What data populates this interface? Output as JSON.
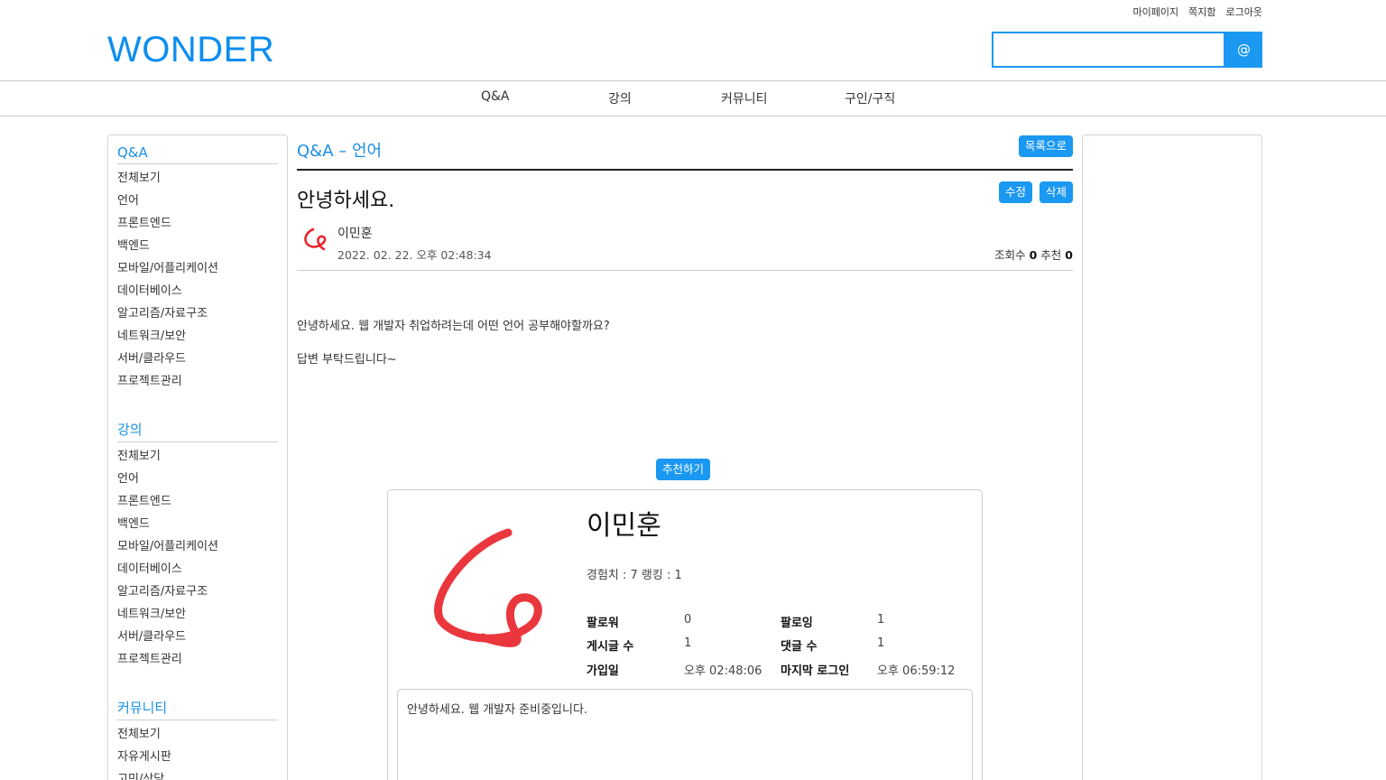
{
  "header": {
    "top_links": [
      "마이페이지",
      "쪽지함",
      "로그아웃"
    ],
    "logo": "WONDER",
    "search": {
      "value": "",
      "button": "@"
    }
  },
  "nav": [
    "Q&A",
    "강의",
    "커뮤니티",
    "구인/구직"
  ],
  "sidebar": [
    {
      "title": "Q&A",
      "items": [
        "전체보기",
        "언어",
        "프론트엔드",
        "백엔드",
        "모바일/어플리케이션",
        "데이터베이스",
        "알고리즘/자료구조",
        "네트워크/보안",
        "서버/클라우드",
        "프로젝트관리"
      ]
    },
    {
      "title": "강의",
      "items": [
        "전체보기",
        "언어",
        "프론트엔드",
        "백엔드",
        "모바일/어플리케이션",
        "데이터베이스",
        "알고리즘/자료구조",
        "네트워크/보안",
        "서버/클라우드",
        "프로젝트관리"
      ]
    },
    {
      "title": "커뮤니티",
      "items": [
        "전체보기",
        "자유게시판",
        "고민/상담"
      ]
    }
  ],
  "post": {
    "board_title": "Q&A – 언어",
    "list_button": "목록으로",
    "title": "안녕하세요.",
    "edit_button": "수정",
    "delete_button": "삭제",
    "author": "이민훈",
    "date": "2022. 02. 22. 오후 02:48:34",
    "views_label": "조회수",
    "views": "0",
    "likes_label": "추천",
    "likes": "0",
    "content": [
      "안녕하세요. 웹 개발자 취업하려는데 어떤 언어 공부해야할까요?",
      "답변 부탁드립니다~"
    ],
    "recommend_button": "추천하기"
  },
  "profile": {
    "name": "이민훈",
    "exp_rank": "경험치 : 7 랭킹 : 1",
    "stats": [
      {
        "label": "팔로워",
        "value": "0"
      },
      {
        "label": "팔로잉",
        "value": "1"
      },
      {
        "label": "게시글 수",
        "value": "1"
      },
      {
        "label": "댓글 수",
        "value": "1"
      },
      {
        "label": "가입일",
        "value": "오후 02:48:06"
      },
      {
        "label": "마지막 로그인",
        "value": "오후 06:59:12"
      }
    ],
    "intro": "안녕하세요. 웹 개발자 준비중입니다."
  },
  "colors": {
    "accent": "#1a98f2",
    "title_blue": "#1a8fe6",
    "avatar_red": "#e8262c"
  }
}
